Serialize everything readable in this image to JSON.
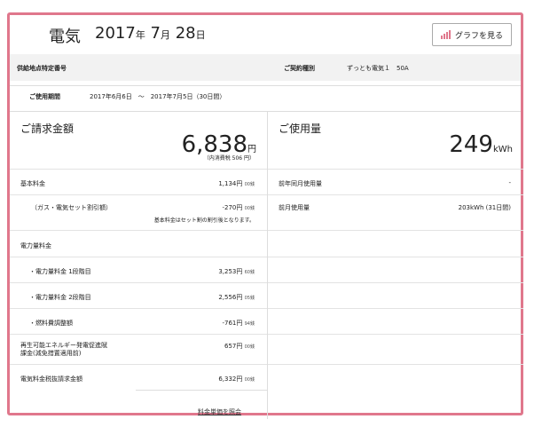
{
  "header": {
    "title": "電気",
    "year": "2017",
    "year_unit": "年",
    "month": "7",
    "month_unit": "月",
    "day": "28",
    "day_unit": "日",
    "graph_button": "グラフを見る"
  },
  "info": {
    "supply_point_label": "供給地点特定番号",
    "contract_type_label": "ご契約種別",
    "contract_type_value": "ずっとも電気１　50A",
    "period_label": "ご使用期間",
    "period_value": "2017年6月6日　～　2017年7月5日（30日間）"
  },
  "billing": {
    "label": "ご請求金額",
    "amount": "6,838",
    "unit": "円",
    "note": "（内消費税 506 円）",
    "rows": [
      {
        "label": "基本料金",
        "value": "1,134円",
        "sen": "00銭"
      },
      {
        "label": "（ガス・電気セット割引額）",
        "value": "-270円",
        "sen": "00銭",
        "note": "基本料金はセット割の割引後となります。"
      },
      {
        "label": "電力量料金",
        "value": "",
        "sen": ""
      },
      {
        "label": "・電力量料金 1段階目",
        "value": "3,253円",
        "sen": "60銭"
      },
      {
        "label": "・電力量料金 2段階目",
        "value": "2,556円",
        "sen": "05銭"
      },
      {
        "label": "・燃料費調整額",
        "value": "-761円",
        "sen": "94銭"
      },
      {
        "label": "再生可能エネルギー発電促進賦",
        "label2": "課金(減免措置適用前)",
        "value": "657円",
        "sen": "00銭"
      },
      {
        "label": "電気料金税抜請求金額",
        "value": "6,332円",
        "sen": "00銭"
      }
    ],
    "detail_link": "料金単価を照会"
  },
  "usage": {
    "label": "ご使用量",
    "amount": "249",
    "unit": "kWh",
    "rows": [
      {
        "label": "前年同月使用量",
        "value": "-"
      },
      {
        "label": "前月使用量",
        "value": "203kWh (31日間)"
      }
    ]
  }
}
